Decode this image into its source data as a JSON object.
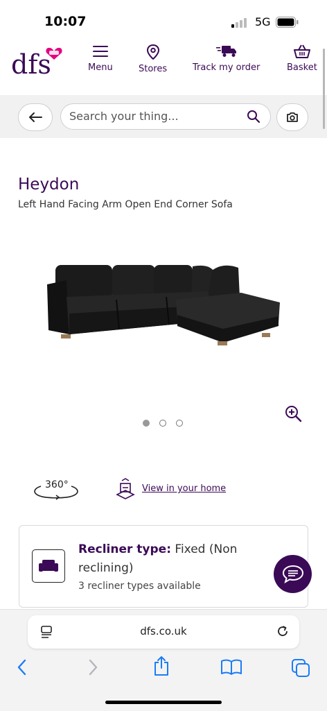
{
  "status_bar": {
    "time": "10:07",
    "network": "5G"
  },
  "header": {
    "logo_text": "dfs",
    "nav": [
      {
        "label": "Menu",
        "icon": "menu-icon"
      },
      {
        "label": "Stores",
        "icon": "location-pin-icon"
      },
      {
        "label": "Track my order",
        "icon": "delivery-truck-icon"
      },
      {
        "label": "Basket",
        "icon": "basket-icon"
      }
    ]
  },
  "search": {
    "placeholder": "Search your thing..."
  },
  "product": {
    "name": "Heydon",
    "description": "Left Hand Facing Arm Open End Corner Sofa",
    "gallery": {
      "total_images": 3,
      "active_index": 0
    },
    "view_360_label": "360°",
    "view_in_home_label": "View in your home",
    "recliner": {
      "label": "Recliner type:",
      "value": "Fixed (Non reclining)",
      "available": "3 recliner types available"
    }
  },
  "browser": {
    "url": "dfs.co.uk"
  },
  "colors": {
    "brand_purple": "#3b0a56",
    "brand_pink": "#e6007e",
    "ios_blue": "#1a7cf6"
  }
}
